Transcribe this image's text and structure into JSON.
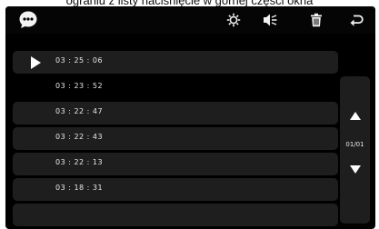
{
  "caption": "ograniu z listy naciśnięcie w górnej części okna",
  "toolbar": {
    "icons": [
      "message-icon",
      "gear-icon",
      "speaker-icon",
      "trash-icon",
      "back-icon"
    ]
  },
  "records": [
    {
      "time": "03 : 25 : 06",
      "playing": true
    },
    {
      "time": "03 : 23 : 52"
    },
    {
      "time": "03 : 22 : 47"
    },
    {
      "time": "03 : 22 : 43"
    },
    {
      "time": "03 : 22 : 13"
    },
    {
      "time": "03 : 18 : 31"
    },
    {
      "time": ""
    }
  ],
  "pagination": {
    "label": "01/01"
  },
  "colors": {
    "screen_bg": "#000000",
    "row_bg": "#1e1e1e",
    "text": "#e8e8e8"
  }
}
